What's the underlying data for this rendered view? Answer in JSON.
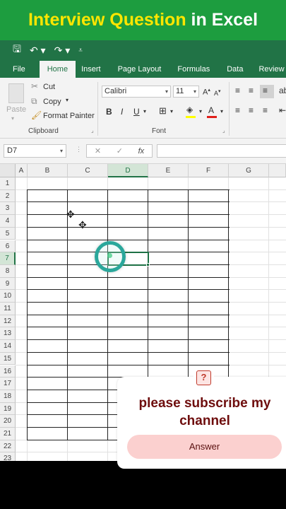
{
  "banner": {
    "part1": "Interview Question",
    "part2": " in Excel"
  },
  "qat": {
    "save_icon": "save-icon",
    "undo_icon": "undo-icon",
    "redo_icon": "redo-icon",
    "customize_icon": "customize-icon"
  },
  "tabs": [
    "File",
    "Home",
    "Insert",
    "Page Layout",
    "Formulas",
    "Data",
    "Review"
  ],
  "ribbon": {
    "clipboard": {
      "paste": "Paste",
      "cut": "Cut",
      "copy": "Copy",
      "format_painter": "Format Painter",
      "label": "Clipboard"
    },
    "font": {
      "name": "Calibri",
      "size": "11",
      "bold": "B",
      "italic": "I",
      "underline": "U",
      "label": "Font"
    }
  },
  "formula_bar": {
    "name_box": "D7",
    "cancel": "✕",
    "enter": "✓",
    "fx": "fx",
    "value": ""
  },
  "grid": {
    "columns": [
      "A",
      "B",
      "C",
      "D",
      "E",
      "F",
      "G"
    ],
    "rows": [
      "1",
      "2",
      "3",
      "4",
      "5",
      "6",
      "7",
      "8",
      "9",
      "10",
      "11",
      "12",
      "13",
      "14",
      "15",
      "16",
      "17",
      "18",
      "19",
      "20",
      "21",
      "22",
      "23"
    ],
    "selected_cell": "D7"
  },
  "popup": {
    "title": "please subscribe my channel",
    "button": "Answer",
    "icon": "question-icon"
  },
  "colors": {
    "excel_green": "#217346",
    "banner_green": "#1d9d3f",
    "banner_yellow": "#ffe600",
    "popup_title": "#6e0d0d",
    "popup_button": "#fbd0cf"
  }
}
